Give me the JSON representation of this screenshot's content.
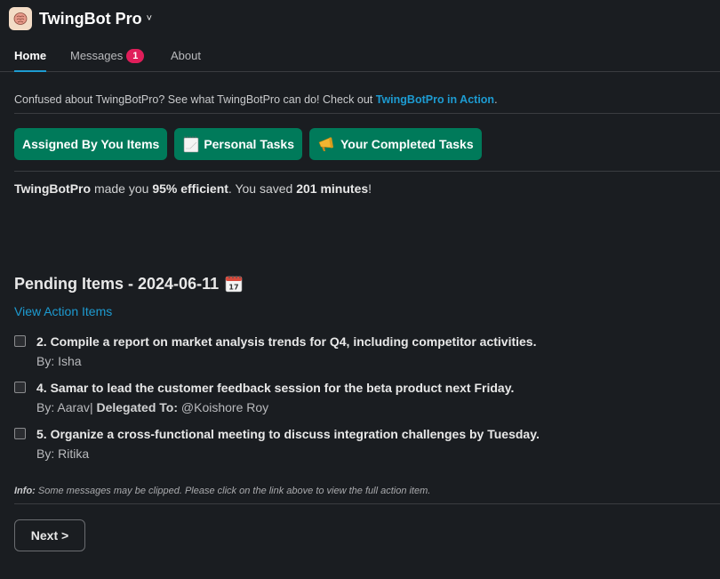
{
  "app": {
    "title": "TwingBot Pro",
    "icon": "brain-app-icon",
    "chevron": "˅"
  },
  "tabs": [
    {
      "label": "Home",
      "active": true
    },
    {
      "label": "Messages",
      "badge": "1"
    },
    {
      "label": "About"
    }
  ],
  "intro": {
    "text": "Confused about TwingBotPro? See what TwingBotPro can do! Check out ",
    "link": "TwingBotPro in Action",
    "suffix": "."
  },
  "buttons": {
    "assigned": "Assigned By You Items",
    "personal": "Personal Tasks",
    "completed": "Your Completed Tasks"
  },
  "stats": {
    "app_name": "TwingBotPro",
    "t1": " made you ",
    "efficiency": "95% efficient",
    "t2": ". You saved ",
    "minutes": "201 minutes",
    "t3": "!"
  },
  "pending": {
    "title": "Pending Items - 2024-06-11",
    "view_link": "View Action Items",
    "items": [
      {
        "text": "2. Compile a report on market analysis trends for Q4, including competitor activities.",
        "by_label": "By: ",
        "by": "Isha"
      },
      {
        "text": "4. Samar to lead the customer feedback session for the beta product next Friday.",
        "by_label": "By: ",
        "by": "Aarav",
        "sep": "| ",
        "delegated_label": "Delegated To:",
        "delegated": " @Koishore Roy"
      },
      {
        "text": "5. Organize a cross-functional meeting to discuss integration challenges by Tuesday.",
        "by_label": "By: ",
        "by": "Ritika"
      }
    ]
  },
  "info": {
    "label": "Info:",
    "text": " Some messages may be clipped. Please click on the link above to view the full action item."
  },
  "next_label": "Next >",
  "colors": {
    "background": "#1a1d21",
    "accent_green": "#007a5a",
    "link_blue": "#1d9bd1",
    "badge_red": "#e01e5a"
  }
}
